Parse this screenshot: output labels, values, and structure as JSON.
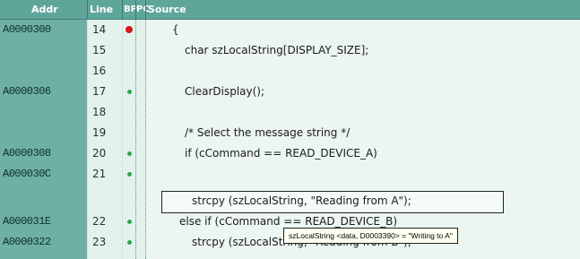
{
  "header": {
    "addr": "Addr",
    "line": "Line",
    "bp": "BP",
    "pc": "PC",
    "source": "Source"
  },
  "rows": [
    {
      "addr": "A0000300",
      "line": "14",
      "marker": "breakpoint",
      "code": "{"
    },
    {
      "addr": "",
      "line": "15",
      "marker": "",
      "code": "char szLocalString[DISPLAY_SIZE];"
    },
    {
      "addr": "",
      "line": "16",
      "marker": "",
      "code": ""
    },
    {
      "addr": "A0000306",
      "line": "17",
      "marker": "dot",
      "code": "ClearDisplay();"
    },
    {
      "addr": "",
      "line": "18",
      "marker": "",
      "code": ""
    },
    {
      "addr": "",
      "line": "19",
      "marker": "",
      "code": "/* Select the message string */"
    },
    {
      "addr": "A0000308",
      "line": "20",
      "marker": "dot",
      "code": "if (cCommand == READ_DEVICE_A)"
    },
    {
      "addr": "A000030C",
      "line": "21",
      "marker": "dot",
      "code": "strcpy (szLocalString, \"Reading from A\");"
    },
    {
      "addr": "A000031E",
      "line": "22",
      "marker": "dot",
      "code": "else if (cCommand == READ_DEVICE_B)"
    },
    {
      "addr": "A0000322",
      "line": "23",
      "marker": "dot",
      "code": "strcpy (szLocalString, \"Reading from B\");"
    }
  ],
  "tooltip": "szLocalString <data, D0003390> = \"Writing to A\"",
  "colors": {
    "header_bg": "#5fa69a",
    "addr_bg": "#6fb0a6",
    "breakpoint": "#d81818",
    "exec_dot": "#2aa84a"
  }
}
